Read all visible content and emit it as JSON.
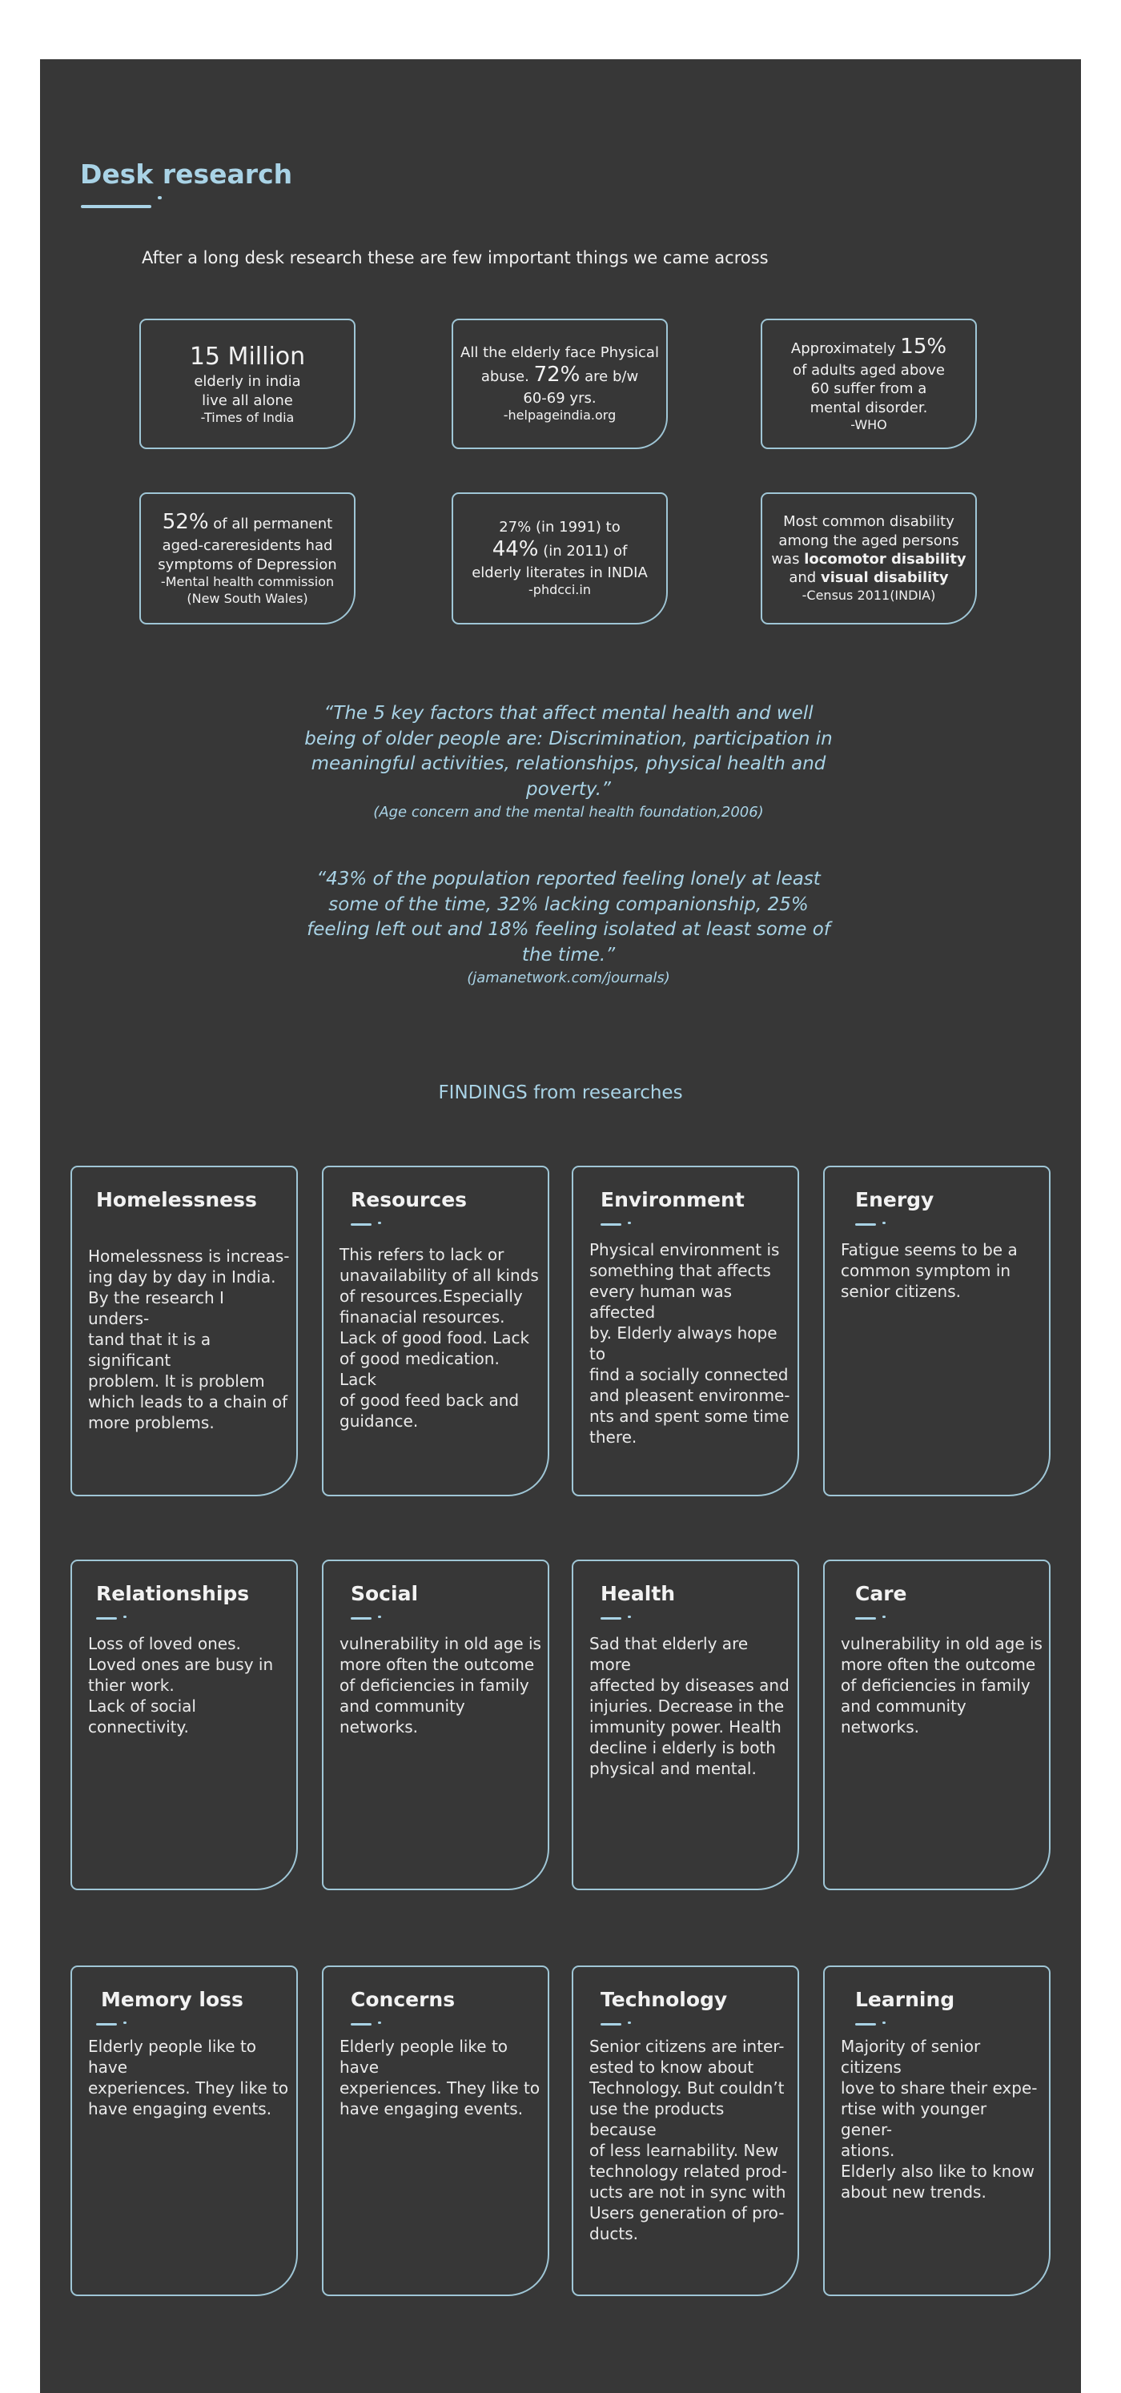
{
  "header": {
    "title": "Desk research",
    "intro": "After a long desk research these are few important things we  came across"
  },
  "stats": [
    {
      "big": "15  Million",
      "line1": "elderly in india",
      "line2": "live all alone",
      "source": "-Times of India"
    },
    {
      "line1": "All the elderly face Physical",
      "pre": "abuse.",
      "pct": "72%",
      "post": "are b/w",
      "line3": "60-69 yrs.",
      "source": "-helpageindia.org"
    },
    {
      "pre": "Approximately",
      "pct": "15%",
      "line1": "of adults aged above",
      "line2": "60 suffer from a",
      "line3": "mental disorder.",
      "source": "-WHO"
    },
    {
      "pct": "52%",
      "post": "of all permanent",
      "line1": "aged-careresidents had",
      "line2": "symptoms of Depression",
      "source": "-Mental health commission",
      "source2": "(New South Wales)"
    },
    {
      "line1": "27% (in 1991) to",
      "pct": "44%",
      "post": "(in 2011) of",
      "line2": "elderly literates in INDIA",
      "source": "-phdcci.in"
    },
    {
      "line1": "Most common disability",
      "line2": "among the aged persons",
      "pre": "was",
      "bold1": "locomotor disability",
      "and": "and",
      "bold2": "visual disability",
      "source": "-Census 2011(INDIA)"
    }
  ],
  "quotes": [
    {
      "text": "“The 5 key factors that affect mental health and well being of older people are: Discrimination, participation in meaningful activities, relationships, physical health and poverty.”",
      "source": "(Age concern and the mental health foundation,2006)"
    },
    {
      "text": "“43% of the population reported feeling lonely at least some of the time, 32% lacking companionship, 25% feeling left out and 18% feeling isolated at least some of the time.”",
      "source": "(jamanetwork.com/journals)"
    }
  ],
  "findings": {
    "heading": "FINDINGS from researches",
    "cards": [
      {
        "title": "Homelessness",
        "body": "Homelessness is increas-\ning day by day in India.\nBy the research I unders-\ntand that it is a significant\nproblem. It is problem\nwhich leads to a chain of\nmore problems."
      },
      {
        "title": "Resources",
        "body": "This refers to lack or\nunavailability of all kinds\nof resources.Especially\nfinanacial resources.\nLack of good food. Lack\nof good medication. Lack\nof good feed back and\nguidance."
      },
      {
        "title": "Environment",
        "body": "Physical environment is\nsomething that affects\nevery human was affected\nby. Elderly always hope to\nfind a socially connected\nand pleasent environme-\nnts and spent some time\nthere."
      },
      {
        "title": "Energy",
        "body": "Fatigue seems to be a\ncommon symptom in\nsenior citizens."
      },
      {
        "title": "Relationships",
        "body": "Loss of loved ones.\nLoved ones are busy in\nthier work.\nLack of social connectivity."
      },
      {
        "title": "Social",
        "body": "vulnerability in old age is\nmore often the outcome\nof deficiencies in family\nand community networks."
      },
      {
        "title": "Health",
        "body": "Sad that elderly are more\naffected by diseases and\ninjuries. Decrease in the\nimmunity power. Health\ndecline i elderly is both\nphysical and mental."
      },
      {
        "title": "Care",
        "body": "vulnerability in old age is\nmore often the outcome\nof deficiencies in family\nand community networks."
      },
      {
        "title": "Memory loss",
        "body": "Elderly people like to have\nexperiences. They like to\nhave engaging events."
      },
      {
        "title": "Concerns",
        "body": "Elderly people like to have\nexperiences. They like to\nhave engaging events."
      },
      {
        "title": "Technology",
        "body": "Senior citizens are inter-\nested to know about\nTechnology. But couldn’t\nuse the products because\nof less learnability. New\ntechnology related prod-\nucts are not in sync with\nUsers generation of pro-\nducts."
      },
      {
        "title": "Learning",
        "body": "Majority of senior citizens\nlove to share their expe-\nrtise with younger gener-\nations.\nElderly also like to know\nabout new trends."
      }
    ]
  },
  "colors": {
    "background": "#373737",
    "accent": "#a9d3e6",
    "border": "#9fc6d6"
  }
}
